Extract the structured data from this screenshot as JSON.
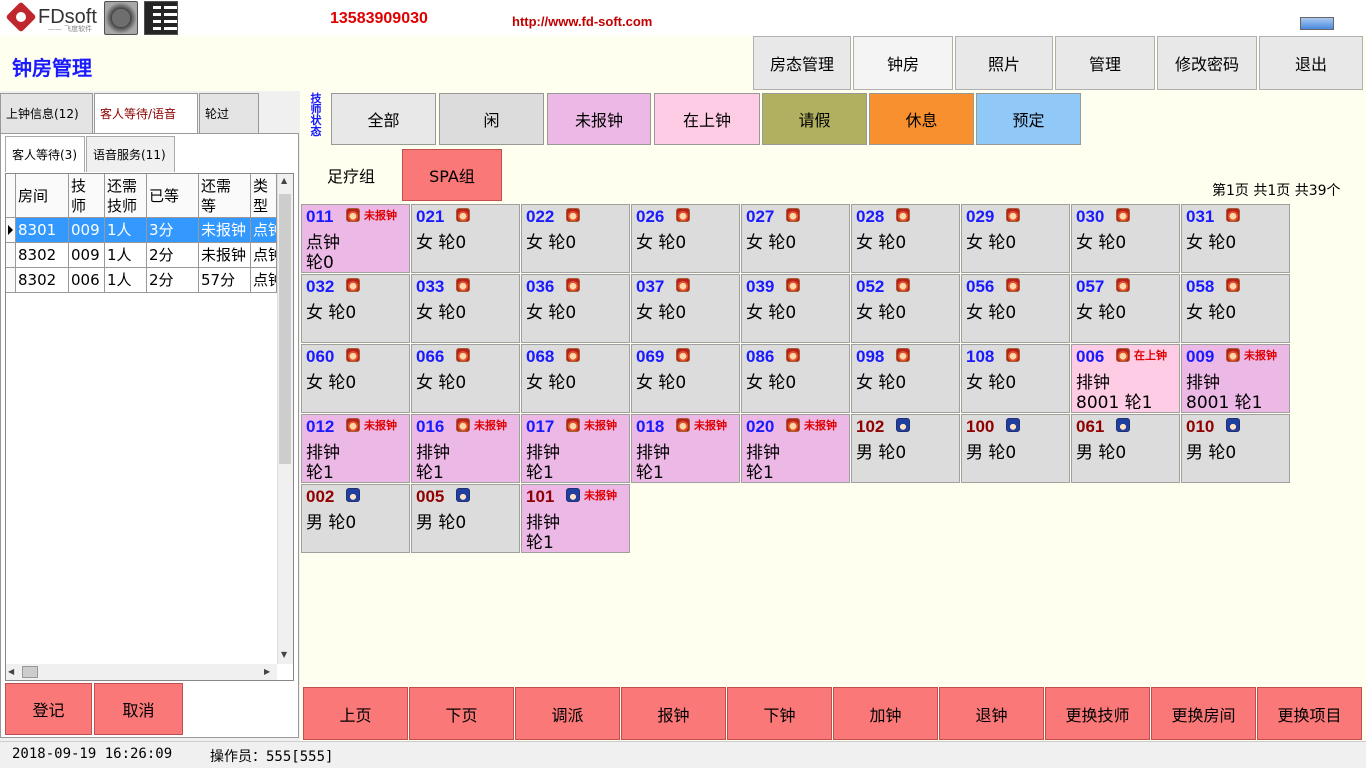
{
  "header": {
    "logo": "FDsoft",
    "logo_sub": "—— 飞度软件 ——",
    "phone": "13583909030",
    "url": "http://www.fd-soft.com"
  },
  "title": "钟房管理",
  "nav": [
    "房态管理",
    "钟房",
    "照片",
    "管理",
    "修改密码",
    "退出"
  ],
  "left": {
    "tabs": [
      "上钟信息(12)",
      "客人等待/语音",
      "轮过"
    ],
    "subtabs": [
      "客人等待(3)",
      "语音服务(11)"
    ],
    "columns": [
      "房间",
      "技\n师",
      "还需\n技师",
      "已等",
      "还需\n等",
      "类\n型"
    ],
    "rows": [
      [
        "8301",
        "009",
        "1人",
        "3分",
        "未报钟",
        "点钟"
      ],
      [
        "8302",
        "009",
        "1人",
        "2分",
        "未报钟",
        "点钟"
      ],
      [
        "8302",
        "006",
        "1人",
        "2分",
        "57分",
        "点钟"
      ]
    ],
    "buttons": [
      "登记",
      "取消"
    ]
  },
  "status_label": "技师状态",
  "filters": [
    {
      "label": "全部",
      "color": "#e8e8e8"
    },
    {
      "label": "闲",
      "color": "#dcdcdc"
    },
    {
      "label": "未报钟",
      "color": "#ecb8e6"
    },
    {
      "label": "在上钟",
      "color": "#ffcce6"
    },
    {
      "label": "请假",
      "color": "#b0b060"
    },
    {
      "label": "休息",
      "color": "#f89030"
    },
    {
      "label": "预定",
      "color": "#90c8f8"
    }
  ],
  "groups": [
    "足疗组",
    "SPA组"
  ],
  "page_info": "第1页 共1页 共39个",
  "techs": [
    {
      "num": "011",
      "g": "f",
      "tag": "未报钟",
      "l2": "点钟",
      "l3": " 轮0",
      "s": "p"
    },
    {
      "num": "021",
      "g": "f",
      "tag": "",
      "l2": "女 轮0",
      "l3": "",
      "s": ""
    },
    {
      "num": "022",
      "g": "f",
      "tag": "",
      "l2": "女 轮0",
      "l3": "",
      "s": ""
    },
    {
      "num": "026",
      "g": "f",
      "tag": "",
      "l2": "女 轮0",
      "l3": "",
      "s": ""
    },
    {
      "num": "027",
      "g": "f",
      "tag": "",
      "l2": "女 轮0",
      "l3": "",
      "s": ""
    },
    {
      "num": "028",
      "g": "f",
      "tag": "",
      "l2": "女 轮0",
      "l3": "",
      "s": ""
    },
    {
      "num": "029",
      "g": "f",
      "tag": "",
      "l2": "女 轮0",
      "l3": "",
      "s": ""
    },
    {
      "num": "030",
      "g": "f",
      "tag": "",
      "l2": "女 轮0",
      "l3": "",
      "s": ""
    },
    {
      "num": "031",
      "g": "f",
      "tag": "",
      "l2": "女 轮0",
      "l3": "",
      "s": ""
    },
    {
      "num": "032",
      "g": "f",
      "tag": "",
      "l2": "女 轮0",
      "l3": "",
      "s": ""
    },
    {
      "num": "033",
      "g": "f",
      "tag": "",
      "l2": "女 轮0",
      "l3": "",
      "s": ""
    },
    {
      "num": "036",
      "g": "f",
      "tag": "",
      "l2": "女 轮0",
      "l3": "",
      "s": ""
    },
    {
      "num": "037",
      "g": "f",
      "tag": "",
      "l2": "女 轮0",
      "l3": "",
      "s": ""
    },
    {
      "num": "039",
      "g": "f",
      "tag": "",
      "l2": "女 轮0",
      "l3": "",
      "s": ""
    },
    {
      "num": "052",
      "g": "f",
      "tag": "",
      "l2": "女 轮0",
      "l3": "",
      "s": ""
    },
    {
      "num": "056",
      "g": "f",
      "tag": "",
      "l2": "女 轮0",
      "l3": "",
      "s": ""
    },
    {
      "num": "057",
      "g": "f",
      "tag": "",
      "l2": "女 轮0",
      "l3": "",
      "s": ""
    },
    {
      "num": "058",
      "g": "f",
      "tag": "",
      "l2": "女 轮0",
      "l3": "",
      "s": ""
    },
    {
      "num": "060",
      "g": "f",
      "tag": "",
      "l2": "女 轮0",
      "l3": "",
      "s": ""
    },
    {
      "num": "066",
      "g": "f",
      "tag": "",
      "l2": "女 轮0",
      "l3": "",
      "s": ""
    },
    {
      "num": "068",
      "g": "f",
      "tag": "",
      "l2": "女 轮0",
      "l3": "",
      "s": ""
    },
    {
      "num": "069",
      "g": "f",
      "tag": "",
      "l2": "女 轮0",
      "l3": "",
      "s": ""
    },
    {
      "num": "086",
      "g": "f",
      "tag": "",
      "l2": "女 轮0",
      "l3": "",
      "s": ""
    },
    {
      "num": "098",
      "g": "f",
      "tag": "",
      "l2": "女 轮0",
      "l3": "",
      "s": ""
    },
    {
      "num": "108",
      "g": "f",
      "tag": "",
      "l2": "女 轮0",
      "l3": "",
      "s": ""
    },
    {
      "num": "006",
      "g": "f",
      "tag": "在上钟",
      "l2": "排钟",
      "l3": "8001 轮1",
      "s": "pk"
    },
    {
      "num": "009",
      "g": "f",
      "tag": "未报钟",
      "l2": "排钟",
      "l3": "8001 轮1",
      "s": "p"
    },
    {
      "num": "012",
      "g": "f",
      "tag": "未报钟",
      "l2": "排钟",
      "l3": " 轮1",
      "s": "p"
    },
    {
      "num": "016",
      "g": "f",
      "tag": "未报钟",
      "l2": "排钟",
      "l3": " 轮1",
      "s": "p"
    },
    {
      "num": "017",
      "g": "f",
      "tag": "未报钟",
      "l2": "排钟",
      "l3": " 轮1",
      "s": "p"
    },
    {
      "num": "018",
      "g": "f",
      "tag": "未报钟",
      "l2": "排钟",
      "l3": " 轮1",
      "s": "p"
    },
    {
      "num": "020",
      "g": "f",
      "tag": "未报钟",
      "l2": "排钟",
      "l3": " 轮1",
      "s": "p"
    },
    {
      "num": "102",
      "g": "m",
      "tag": "",
      "l2": "男 轮0",
      "l3": "",
      "s": ""
    },
    {
      "num": "100",
      "g": "m",
      "tag": "",
      "l2": "男 轮0",
      "l3": "",
      "s": ""
    },
    {
      "num": "061",
      "g": "m",
      "tag": "",
      "l2": "男 轮0",
      "l3": "",
      "s": ""
    },
    {
      "num": "010",
      "g": "m",
      "tag": "",
      "l2": "男 轮0",
      "l3": "",
      "s": ""
    },
    {
      "num": "002",
      "g": "m",
      "tag": "",
      "l2": "男 轮0",
      "l3": "",
      "s": ""
    },
    {
      "num": "005",
      "g": "m",
      "tag": "",
      "l2": "男 轮0",
      "l3": "",
      "s": ""
    },
    {
      "num": "101",
      "g": "m",
      "tag": "未报钟",
      "l2": "排钟",
      "l3": " 轮1",
      "s": "p"
    }
  ],
  "actions": [
    "上页",
    "下页",
    "调派",
    "报钟",
    "下钟",
    "加钟",
    "退钟",
    "更换技师",
    "更换房间",
    "更换项目"
  ],
  "statusbar": {
    "time": "2018-09-19 16:26:09",
    "operator": "操作员：555[555]"
  }
}
